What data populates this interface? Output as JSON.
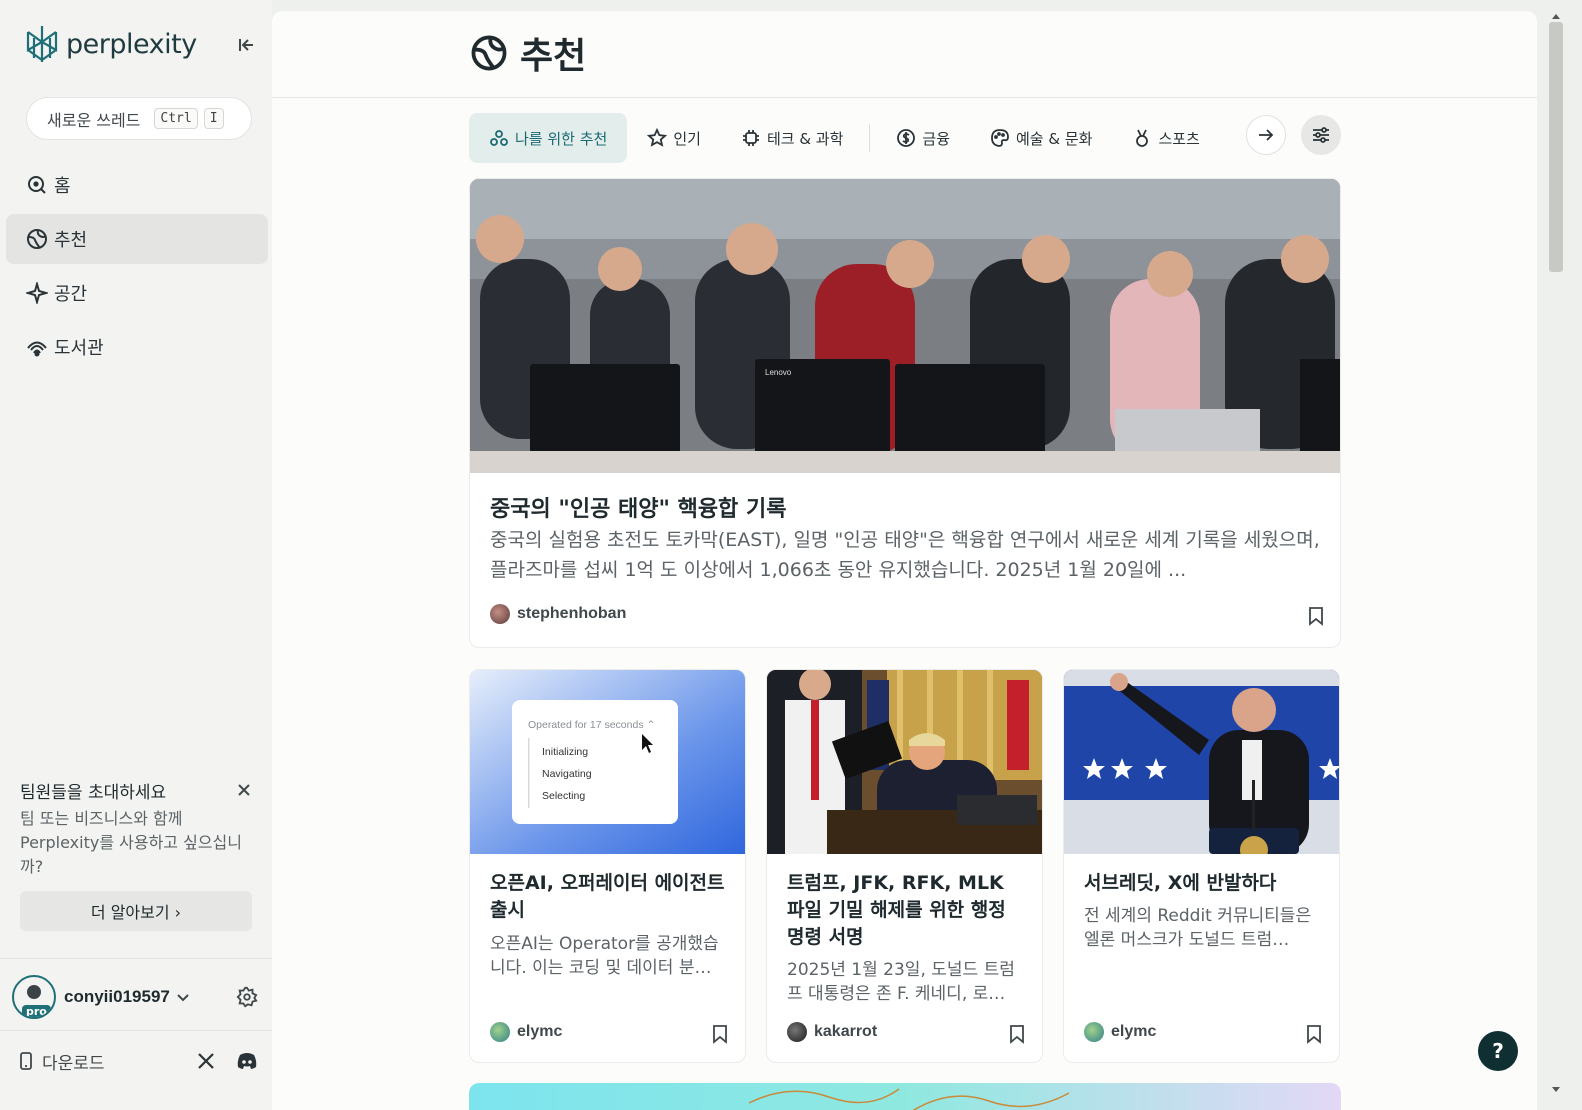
{
  "sidebar": {
    "logo_text": "perplexity",
    "new_thread": {
      "label": "새로운 쓰레드",
      "kbd": [
        "Ctrl",
        "I"
      ]
    },
    "nav": [
      {
        "label": "홈",
        "icon": "search-icon"
      },
      {
        "label": "추천",
        "icon": "globe-icon",
        "active": true
      },
      {
        "label": "공간",
        "icon": "sparkle-icon"
      },
      {
        "label": "도서관",
        "icon": "library-icon"
      }
    ],
    "invite": {
      "title": "팀원들을 초대하세요",
      "description": "팀 또는 비즈니스와 함께 Perplexity를 사용하고 싶으십니까?",
      "button": "더 알아보기 ›"
    },
    "user": {
      "name": "conyii019597",
      "badge": "pro"
    },
    "download_label": "다운로드"
  },
  "main": {
    "page_title": "추천",
    "tabs": [
      {
        "label": "나를 위한 추천",
        "icon": "people-icon",
        "active": true
      },
      {
        "label": "인기",
        "icon": "star-icon"
      },
      {
        "label": "테크 & 과학",
        "icon": "chip-icon"
      },
      {
        "label": "금융",
        "icon": "dollar-icon"
      },
      {
        "label": "예술 & 문화",
        "icon": "palette-icon"
      },
      {
        "label": "스포츠",
        "icon": "medal-icon"
      }
    ],
    "hero": {
      "title": "중국의 \"인공 태양\" 핵융합 기록",
      "description": "중국의 실험용 초전도 토카막(EAST), 일명 \"인공 태양\"은 핵융합 연구에서 새로운 세계 기록을 세웠으며, 플라즈마를 섭씨 1억 도 이상에서 1,066초 동안 유지했습니다. 2025년 1월 20일에 ...",
      "author": "stephenhoban",
      "monitor_label": "Lenovo"
    },
    "cards": [
      {
        "title": "오픈AI, 오퍼레이터 에이전트 출시",
        "description": "오픈AI는 Operator를 공개했습니다. 이는 코딩 및 데이터 분…",
        "author": "elymc",
        "image_texts": {
          "header": "Operated for 17 seconds ⌃",
          "items": [
            "Initializing",
            "Navigating",
            "Selecting"
          ]
        }
      },
      {
        "title": "트럼프, JFK, RFK, MLK 파일 기밀 해제를 위한 행정 명령 서명",
        "description": "2025년 1월 23일, 도널드 트럼프 대통령은 존 F. 케네디, 로…",
        "author": "kakarrot"
      },
      {
        "title": "서브레딧, X에 반발하다",
        "description": "전 세계의 Reddit 커뮤니티들은 엘론 머스크가 도널드 트럼…",
        "author": "elymc"
      }
    ],
    "help_label": "?"
  },
  "colors": {
    "brand_teal": "#1f6f78",
    "active_tab_bg": "#e3edec",
    "sidebar_bg": "#f3f4f1",
    "help_bg": "#0f2f33"
  }
}
